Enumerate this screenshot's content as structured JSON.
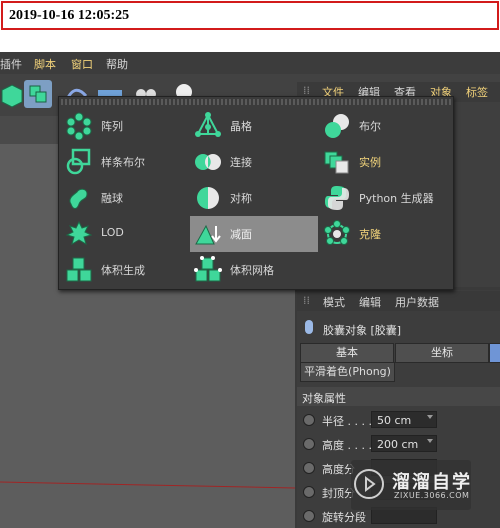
{
  "timestamp": "2019-10-16 12:05:25",
  "menubar": [
    {
      "label": "插件",
      "highlight": false
    },
    {
      "label": "脚本",
      "highlight": true
    },
    {
      "label": "窗口",
      "highlight": true
    },
    {
      "label": "帮助",
      "highlight": false
    }
  ],
  "object_manager": {
    "tabs": [
      {
        "label": "文件",
        "highlight": true
      },
      {
        "label": "编辑",
        "highlight": false
      },
      {
        "label": "查看",
        "highlight": false
      },
      {
        "label": "对象",
        "highlight": true
      },
      {
        "label": "标签",
        "highlight": true
      }
    ]
  },
  "popup": {
    "items": [
      {
        "label": "阵列",
        "icon": "array-icon",
        "highlight": false,
        "selected": false
      },
      {
        "label": "晶格",
        "icon": "atom-array-icon",
        "highlight": false,
        "selected": false
      },
      {
        "label": "布尔",
        "icon": "boole-icon",
        "highlight": false,
        "selected": false
      },
      {
        "label": "样条布尔",
        "icon": "spline-boole-icon",
        "highlight": false,
        "selected": false
      },
      {
        "label": "连接",
        "icon": "connect-icon",
        "highlight": false,
        "selected": false
      },
      {
        "label": "实例",
        "icon": "instance-icon",
        "highlight": true,
        "selected": false
      },
      {
        "label": "融球",
        "icon": "metaball-icon",
        "highlight": false,
        "selected": false
      },
      {
        "label": "对称",
        "icon": "symmetry-icon",
        "highlight": false,
        "selected": false
      },
      {
        "label": "Python 生成器",
        "icon": "python-generator-icon",
        "highlight": false,
        "selected": false
      },
      {
        "label": "LOD",
        "icon": "lod-icon",
        "highlight": false,
        "selected": false
      },
      {
        "label": "减面",
        "icon": "polygon-reduction-icon",
        "highlight": false,
        "selected": true
      },
      {
        "label": "克隆",
        "icon": "cloner-icon",
        "highlight": true,
        "selected": false
      },
      {
        "label": "体积生成",
        "icon": "volume-builder-icon",
        "highlight": false,
        "selected": false
      },
      {
        "label": "体积网格",
        "icon": "volume-mesher-icon",
        "highlight": false,
        "selected": false
      }
    ]
  },
  "attributes": {
    "tabs": [
      "模式",
      "编辑",
      "用户数据"
    ],
    "object_title": "胶囊对象 [胶囊]",
    "section_tabs": [
      "基本",
      "坐标"
    ],
    "phong": "平滑着色(Phong)",
    "section_title": "对象属性",
    "props": [
      {
        "label": "半径 . . . .",
        "value": "50 cm"
      },
      {
        "label": "高度 . . . .",
        "value": "200 cm"
      },
      {
        "label": "高度分",
        "value": ""
      },
      {
        "label": "封顶分",
        "value": ""
      },
      {
        "label": "旋转分段",
        "value": ""
      }
    ]
  },
  "watermark": {
    "title": "溜溜自学",
    "sub": "ZIXUE.3066.COM"
  },
  "colors": {
    "accent_green": "#3fd79a",
    "highlight_text": "#f4d67c",
    "timestamp_border": "#d21b1b"
  }
}
